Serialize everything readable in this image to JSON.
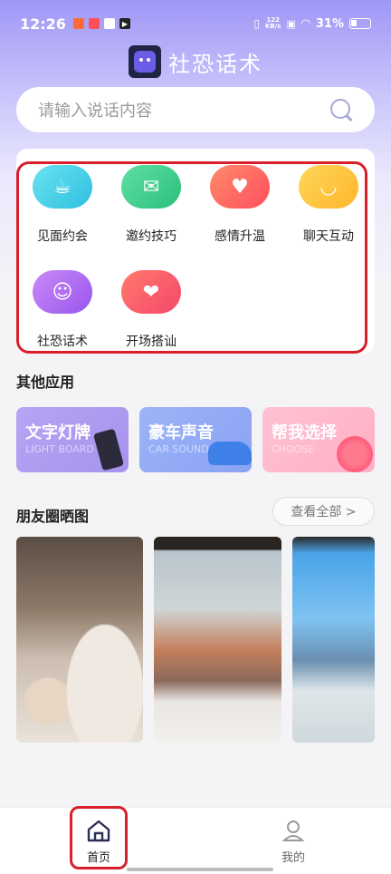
{
  "status": {
    "time": "12:26",
    "net_top": "122",
    "net_bottom": "KB/s",
    "battery": "31%"
  },
  "header": {
    "title": "社恐话术"
  },
  "search": {
    "placeholder": "请输入说话内容"
  },
  "categories": [
    {
      "label": "见面约会",
      "icon": "coffee-cup-icon",
      "color": "#4fd1e6"
    },
    {
      "label": "邀约技巧",
      "icon": "envelope-heart-icon",
      "color": "#3fcf8e"
    },
    {
      "label": "感情升温",
      "icon": "heart-pulse-icon",
      "color": "#ff6b6b"
    },
    {
      "label": "聊天互动",
      "icon": "smile-bubble-icon",
      "color": "#ffc93c"
    },
    {
      "label": "社恐话术",
      "icon": "shy-face-icon",
      "color": "#b36cf2"
    },
    {
      "label": "开场搭讪",
      "icon": "chat-heart-icon",
      "color": "#ff5a6e"
    }
  ],
  "other_apps": {
    "title": "其他应用",
    "items": [
      {
        "title": "文字灯牌",
        "subtitle": "LIGHT BOARD",
        "color": "#b9a6f4"
      },
      {
        "title": "豪车声音",
        "subtitle": "CAR SOUND",
        "color": "#92aaf6"
      },
      {
        "title": "帮我选择",
        "subtitle": "CHOOSE",
        "color": "#ffb3c9"
      }
    ]
  },
  "moments": {
    "title": "朋友圈晒图",
    "view_all": "查看全部 >"
  },
  "bottom_nav": {
    "home": "首页",
    "me": "我的"
  }
}
